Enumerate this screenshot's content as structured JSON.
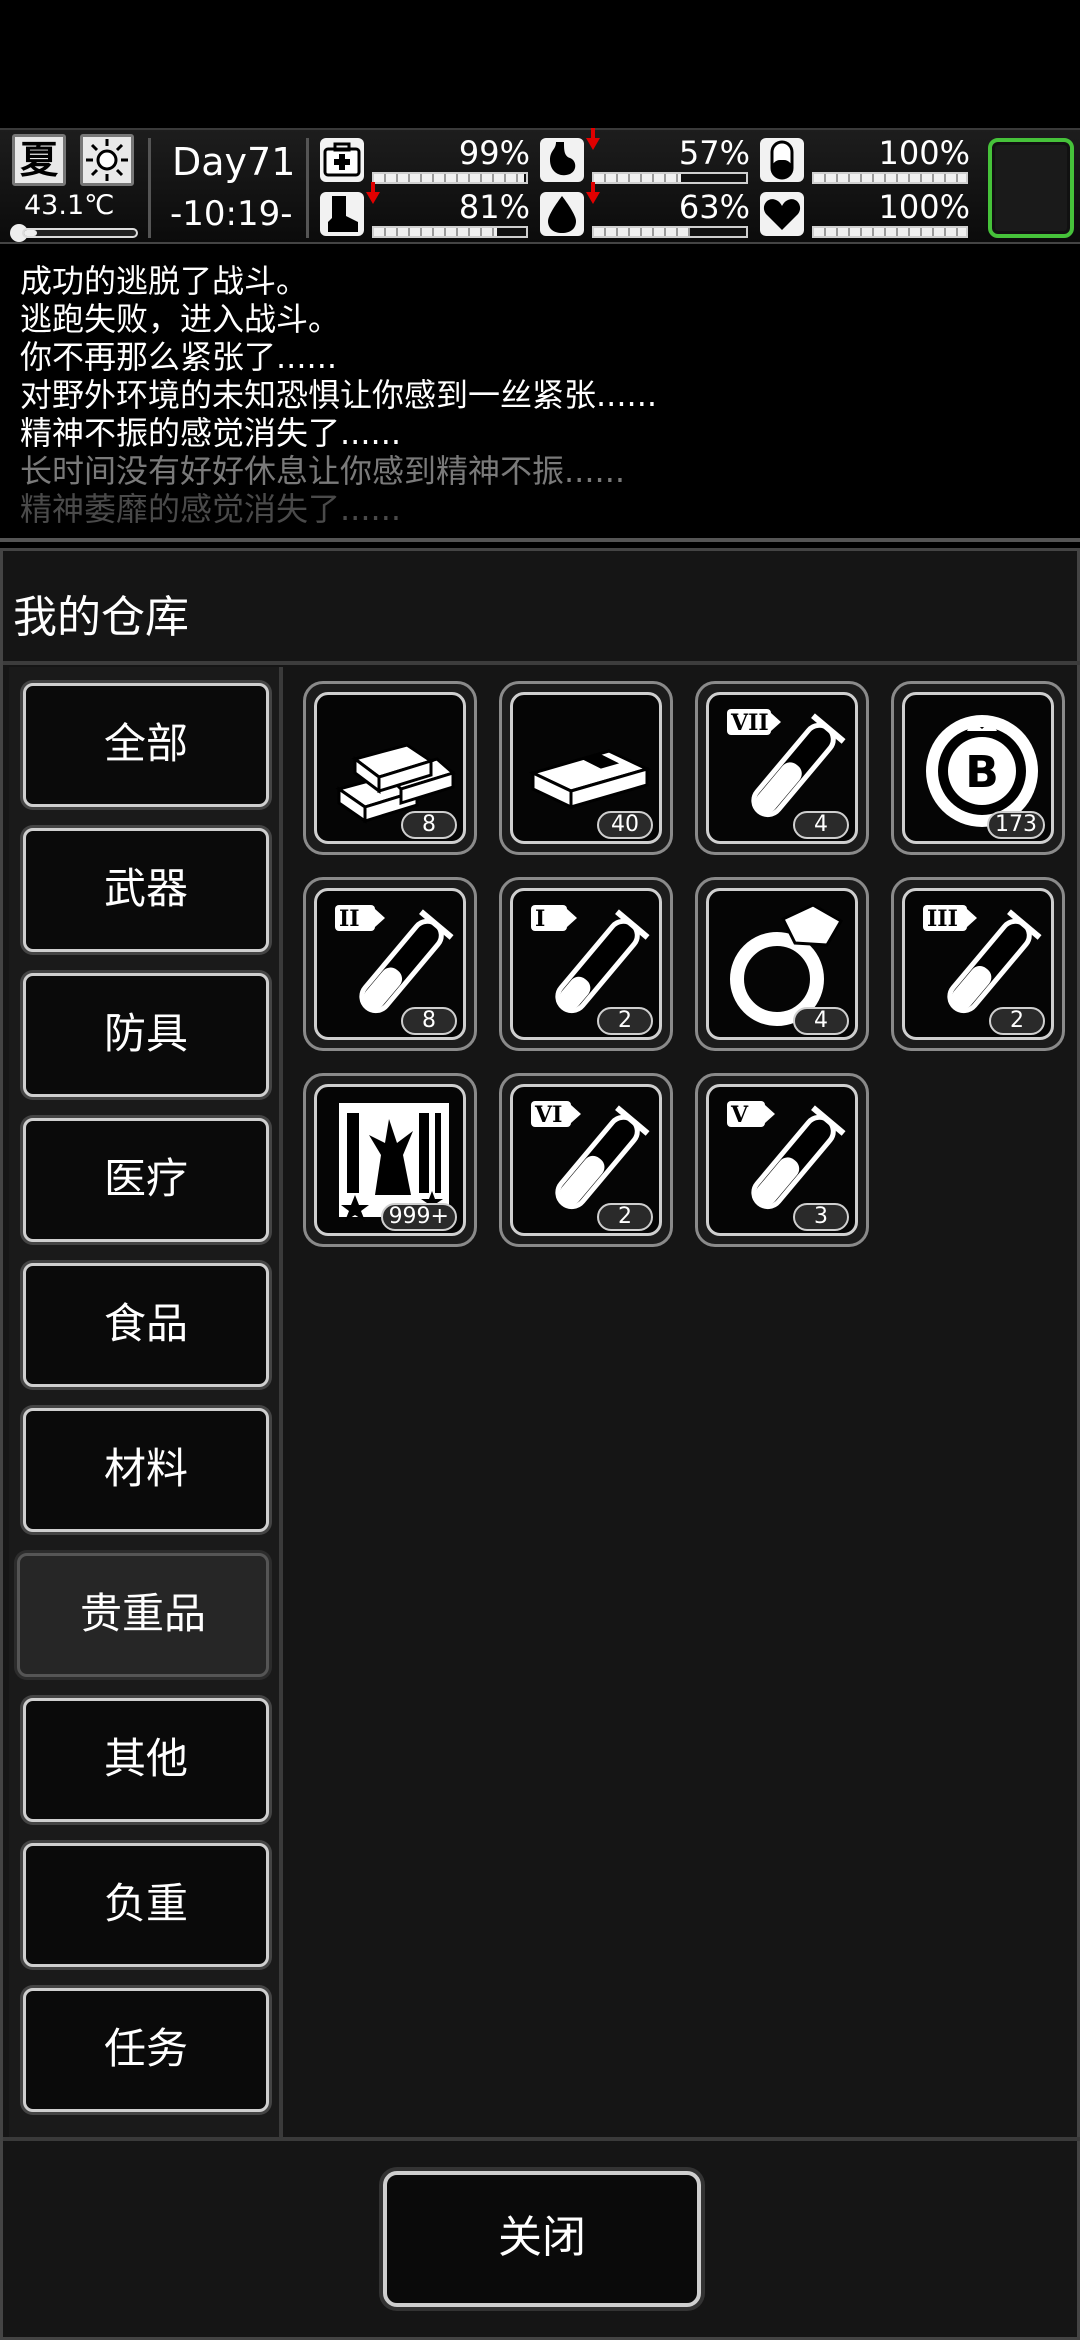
{
  "status": {
    "season": "夏",
    "weather_icon": "sun-icon",
    "temperature": "43.1℃",
    "temperature_level": 0.12,
    "day": "Day71",
    "time": "-10:19-",
    "stats": [
      {
        "name": "health",
        "icon": "medkit-icon",
        "value": "99%",
        "level": 0.99,
        "decreasing": false
      },
      {
        "name": "hunger",
        "icon": "stomach-icon",
        "value": "57%",
        "level": 0.57,
        "decreasing": true
      },
      {
        "name": "mental",
        "icon": "pill-icon",
        "value": "100%",
        "level": 1.0,
        "decreasing": false
      },
      {
        "name": "stamina",
        "icon": "boot-icon",
        "value": "81%",
        "level": 0.81,
        "decreasing": true
      },
      {
        "name": "thirst",
        "icon": "water-drop-icon",
        "value": "63%",
        "level": 0.63,
        "decreasing": true
      },
      {
        "name": "mood",
        "icon": "heart-icon",
        "value": "100%",
        "level": 1.0,
        "decreasing": false
      }
    ]
  },
  "log": [
    {
      "text": "成功的逃脱了战斗。",
      "color": "#ffffff"
    },
    {
      "text": "逃跑失败，进入战斗。",
      "color": "#ffffff"
    },
    {
      "text": "你不再那么紧张了......",
      "color": "#ffffff"
    },
    {
      "text": "对野外环境的未知恐惧让你感到一丝紧张......",
      "color": "#ffffff"
    },
    {
      "text": "精神不振的感觉消失了......",
      "color": "#ffffff"
    },
    {
      "text": "长时间没有好好休息让你感到精神不振......",
      "color": "#7a7a7a"
    },
    {
      "text": "精神萎靡的感觉消失了......",
      "color": "#4a4a4a"
    }
  ],
  "panel": {
    "title": "我的仓库",
    "categories": [
      "全部",
      "武器",
      "防具",
      "医疗",
      "食品",
      "材料",
      "贵重品",
      "其他",
      "负重",
      "任务"
    ],
    "selected_index": 6,
    "items": [
      {
        "icon": "gold-bars-icon",
        "count": "8"
      },
      {
        "icon": "cash-bundle-icon",
        "count": "40"
      },
      {
        "icon": "test-tube-icon",
        "tier": "VII",
        "count": "4"
      },
      {
        "icon": "bitcoin-chip-icon",
        "count": "173"
      },
      {
        "icon": "test-tube-icon",
        "tier": "II",
        "count": "8"
      },
      {
        "icon": "test-tube-icon",
        "tier": "I",
        "count": "2"
      },
      {
        "icon": "diamond-ring-icon",
        "count": "4"
      },
      {
        "icon": "test-tube-icon",
        "tier": "III",
        "count": "2"
      },
      {
        "icon": "lottery-card-icon",
        "count": "999+"
      },
      {
        "icon": "test-tube-icon",
        "tier": "VI",
        "count": "2"
      },
      {
        "icon": "test-tube-icon",
        "tier": "V",
        "count": "3"
      }
    ],
    "close_label": "关闭"
  },
  "colors": {
    "accent_green": "#46c23a",
    "decrease_red": "#e00000"
  }
}
